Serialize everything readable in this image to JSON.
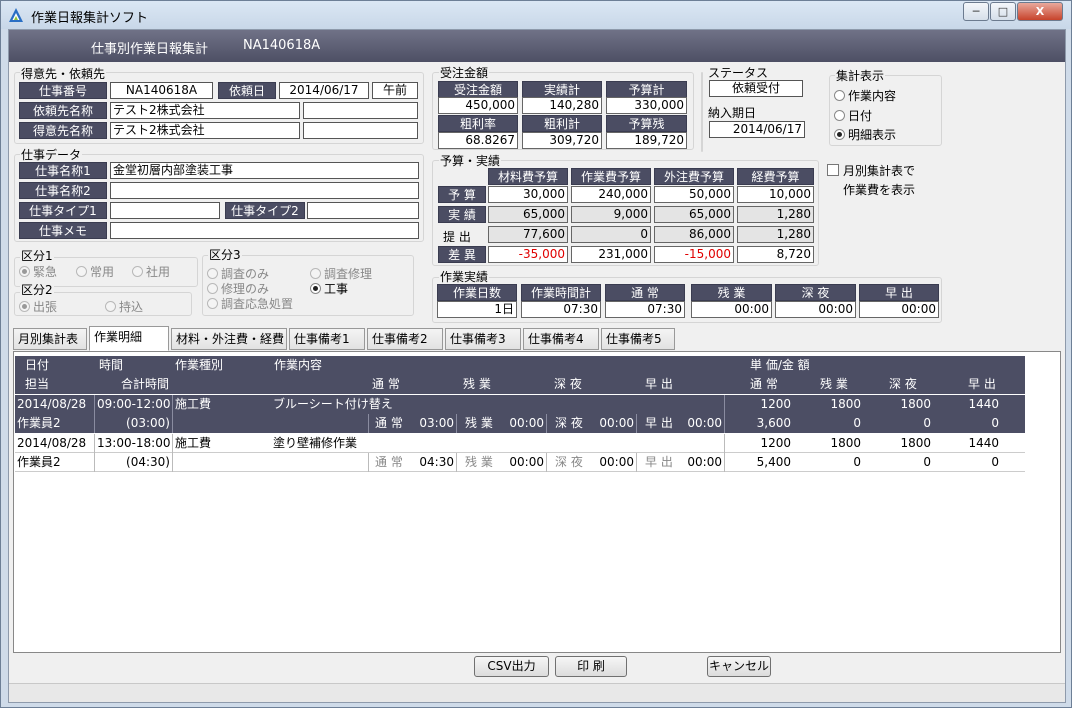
{
  "window": {
    "title": "作業日報集計ソフト",
    "min": "─",
    "max": "□",
    "close": "X"
  },
  "header": {
    "title": "仕事別作業日報集計",
    "job_no": "NA140618A"
  },
  "client": {
    "group_label": "得意先・依頼先",
    "job_no_label": "仕事番号",
    "job_no": "NA140618A",
    "request_date_label": "依頼日",
    "request_date": "2014/06/17",
    "ampm": "午前",
    "requester_label": "依頼先名称",
    "requester": "テスト2株式会社",
    "requester2": "",
    "customer_label": "得意先名称",
    "customer": "テスト2株式会社",
    "customer2": ""
  },
  "order": {
    "group_label": "受注金額",
    "h1": "受注金額",
    "h2": "実績計",
    "h3": "予算計",
    "v1": "450,000",
    "v2": "140,280",
    "v3": "330,000",
    "h4": "粗利率",
    "h5": "粗利計",
    "h6": "予算残",
    "v4": "68.8267",
    "v5": "309,720",
    "v6": "189,720"
  },
  "status": {
    "group_label": "ステータス",
    "value": "依頼受付",
    "due_label": "納入期日",
    "due": "2014/06/17"
  },
  "summary_view": {
    "group_label": "集計表示",
    "opt1": "作業内容",
    "opt2": "日付",
    "opt3": "明細表示"
  },
  "monthly": {
    "line1": "月別集計表で",
    "line2": "作業費を表示"
  },
  "job": {
    "group_label": "仕事データ",
    "name1_label": "仕事名称1",
    "name1": "金堂初層内部塗装工事",
    "name2_label": "仕事名称2",
    "name2": "",
    "type1_label": "仕事タイプ1",
    "type1": "",
    "type2_label": "仕事タイプ2",
    "type2": "",
    "memo_label": "仕事メモ",
    "memo": ""
  },
  "budget": {
    "group_label": "予算・実績",
    "col1": "材料費予算",
    "col2": "作業費予算",
    "col3": "外注費予算",
    "col4": "経費予算",
    "rows": [
      {
        "label": "予 算",
        "v": [
          "30,000",
          "240,000",
          "50,000",
          "10,000"
        ]
      },
      {
        "label": "実 績",
        "v": [
          "65,000",
          "9,000",
          "65,000",
          "1,280"
        ]
      },
      {
        "label": "提 出",
        "v": [
          "77,600",
          "0",
          "86,000",
          "1,280"
        ]
      },
      {
        "label": "差 異",
        "v": [
          "-35,000",
          "231,000",
          "-15,000",
          "8,720"
        ]
      }
    ]
  },
  "kubun1": {
    "label": "区分1",
    "o1": "緊急",
    "o2": "常用",
    "o3": "社用"
  },
  "kubun2": {
    "label": "区分2",
    "o1": "出張",
    "o2": "持込"
  },
  "kubun3": {
    "label": "区分3",
    "o1": "調査のみ",
    "o2": "調査修理",
    "o3": "修理のみ",
    "o4": "工事",
    "o5": "調査応急処置"
  },
  "work": {
    "group_label": "作業実績",
    "h": [
      "作業日数",
      "作業時間計",
      "通 常",
      "残 業",
      "深 夜",
      "早 出"
    ],
    "v": [
      "1日",
      "07:30",
      "07:30",
      "00:00",
      "00:00",
      "00:00"
    ]
  },
  "tabs": [
    "月別集計表",
    "作業明細",
    "材料・外注費・経費",
    "仕事備考1",
    "仕事備考2",
    "仕事備考3",
    "仕事備考4",
    "仕事備考5"
  ],
  "grid": {
    "head1": {
      "date": "日付",
      "time": "時間",
      "type": "作業種別",
      "content": "作業内容",
      "price": "単 価/金 額"
    },
    "head2": {
      "worker": "担当",
      "total": "合計時間",
      "normal": "通 常",
      "over": "残 業",
      "night": "深 夜",
      "early": "早 出",
      "p_normal": "通 常",
      "p_over": "残 業",
      "p_night": "深 夜",
      "p_early": "早 出"
    },
    "rows": [
      {
        "date": "2014/08/28",
        "time": "09:00-12:00",
        "type": "施工費",
        "content": "ブルーシート付け替え",
        "p": [
          "1200",
          "1800",
          "1800",
          "1440"
        ],
        "worker": "作業員2",
        "total": "(03:00)",
        "hours": [
          "通 常",
          "03:00",
          "残 業",
          "00:00",
          "深 夜",
          "00:00",
          "早 出",
          "00:00"
        ],
        "amt": [
          "3,600",
          "0",
          "0",
          "0"
        ]
      },
      {
        "date": "2014/08/28",
        "time": "13:00-18:00",
        "type": "施工費",
        "content": "塗り壁補修作業",
        "p": [
          "1200",
          "1800",
          "1800",
          "1440"
        ],
        "worker": "作業員2",
        "total": "(04:30)",
        "hours": [
          "通 常",
          "04:30",
          "残 業",
          "00:00",
          "深 夜",
          "00:00",
          "早 出",
          "00:00"
        ],
        "amt": [
          "5,400",
          "0",
          "0",
          "0"
        ]
      }
    ]
  },
  "buttons": {
    "csv": "CSV出力",
    "print": "印 刷",
    "cancel": "キャンセル"
  }
}
